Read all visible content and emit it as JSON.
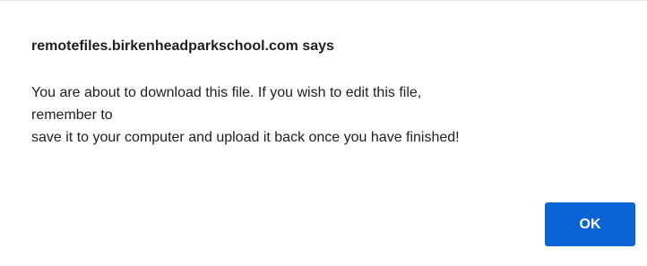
{
  "dialog": {
    "title": "remotefiles.birkenheadparkschool.com says",
    "message_lines": [
      "You are about to download this file. If you wish to edit this file,",
      "remember to",
      "save it to your computer and upload it back once you have finished!"
    ],
    "ok_label": "OK"
  },
  "colors": {
    "button_background": "#0b64d4",
    "button_text": "#ffffff",
    "title_text": "#1f1f1f",
    "body_text": "#202020"
  }
}
